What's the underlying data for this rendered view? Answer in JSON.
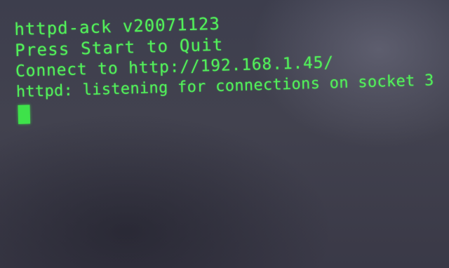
{
  "terminal": {
    "lines": [
      "httpd-ack v20071123",
      "Press Start to Quit",
      "Connect to http://192.168.1.45/",
      "httpd: listening for connections on socket 3"
    ],
    "text_color": "#52f05a",
    "background_color": "#3d3e4d"
  }
}
